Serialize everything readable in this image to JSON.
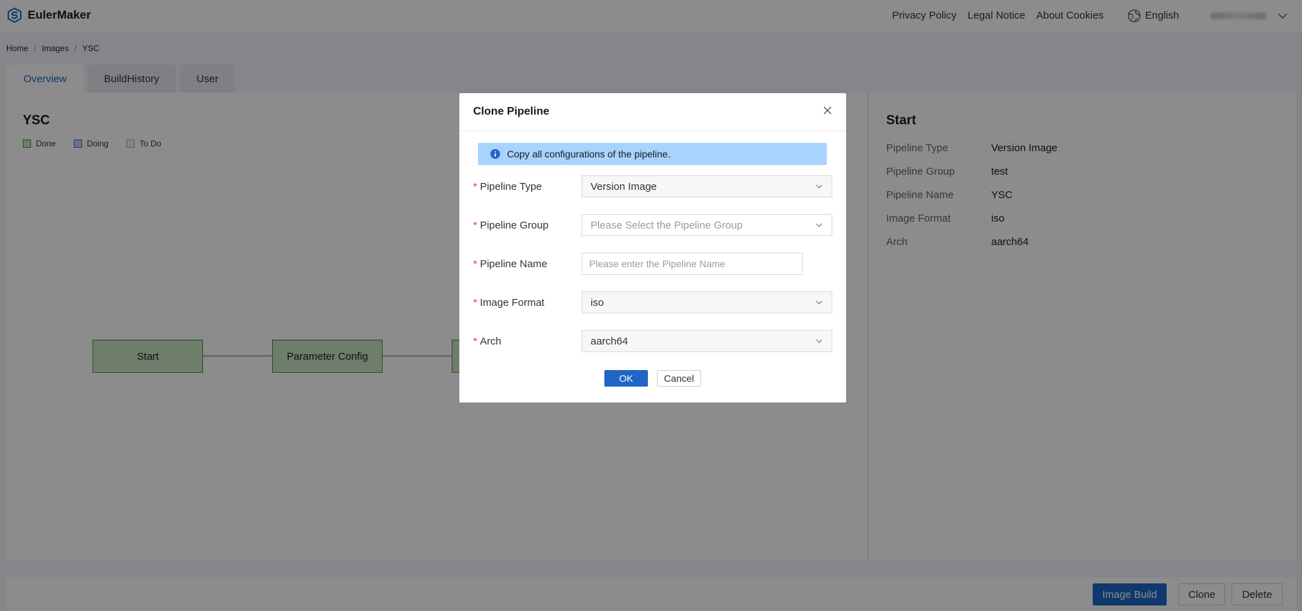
{
  "header": {
    "app_name": "EulerMaker",
    "links": [
      "Privacy Policy",
      "Legal Notice",
      "About Cookies"
    ],
    "language": "English"
  },
  "breadcrumb": [
    "Home",
    "Images",
    "YSC"
  ],
  "tabs": [
    {
      "label": "Overview",
      "active": true
    },
    {
      "label": "BuildHistory",
      "active": false
    },
    {
      "label": "User",
      "active": false
    }
  ],
  "pipeline": {
    "title": "YSC",
    "legend": [
      {
        "label": "Done",
        "color": "#c8e6c4"
      },
      {
        "label": "Doing",
        "color": "#b9d3f2"
      },
      {
        "label": "To Do",
        "color": "#f0f0f0"
      }
    ],
    "nodes": [
      "Start",
      "Parameter Config"
    ]
  },
  "details": {
    "title": "Start",
    "rows": [
      {
        "label": "Pipeline Type",
        "value": "Version Image"
      },
      {
        "label": "Pipeline Group",
        "value": "test"
      },
      {
        "label": "Pipeline Name",
        "value": "YSC"
      },
      {
        "label": "Image Format",
        "value": "iso"
      },
      {
        "label": "Arch",
        "value": "aarch64"
      }
    ]
  },
  "footer": {
    "image_build": "Image Build",
    "clone": "Clone",
    "delete": "Delete"
  },
  "modal": {
    "title": "Clone Pipeline",
    "info": "Copy all configurations of the pipeline.",
    "fields": {
      "pipeline_type": {
        "label": "Pipeline Type",
        "value": "Version Image"
      },
      "pipeline_group": {
        "label": "Pipeline Group",
        "placeholder": "Please Select the Pipeline Group"
      },
      "pipeline_name": {
        "label": "Pipeline Name",
        "placeholder": "Please enter the Pipeline Name"
      },
      "image_format": {
        "label": "Image Format",
        "value": "iso"
      },
      "arch": {
        "label": "Arch",
        "value": "aarch64"
      }
    },
    "ok": "OK",
    "cancel": "Cancel"
  },
  "colors": {
    "primary": "#1f66c7",
    "info_bg": "#a8d3ff",
    "required": "#e33333",
    "node_done": "#c8e6c4"
  }
}
